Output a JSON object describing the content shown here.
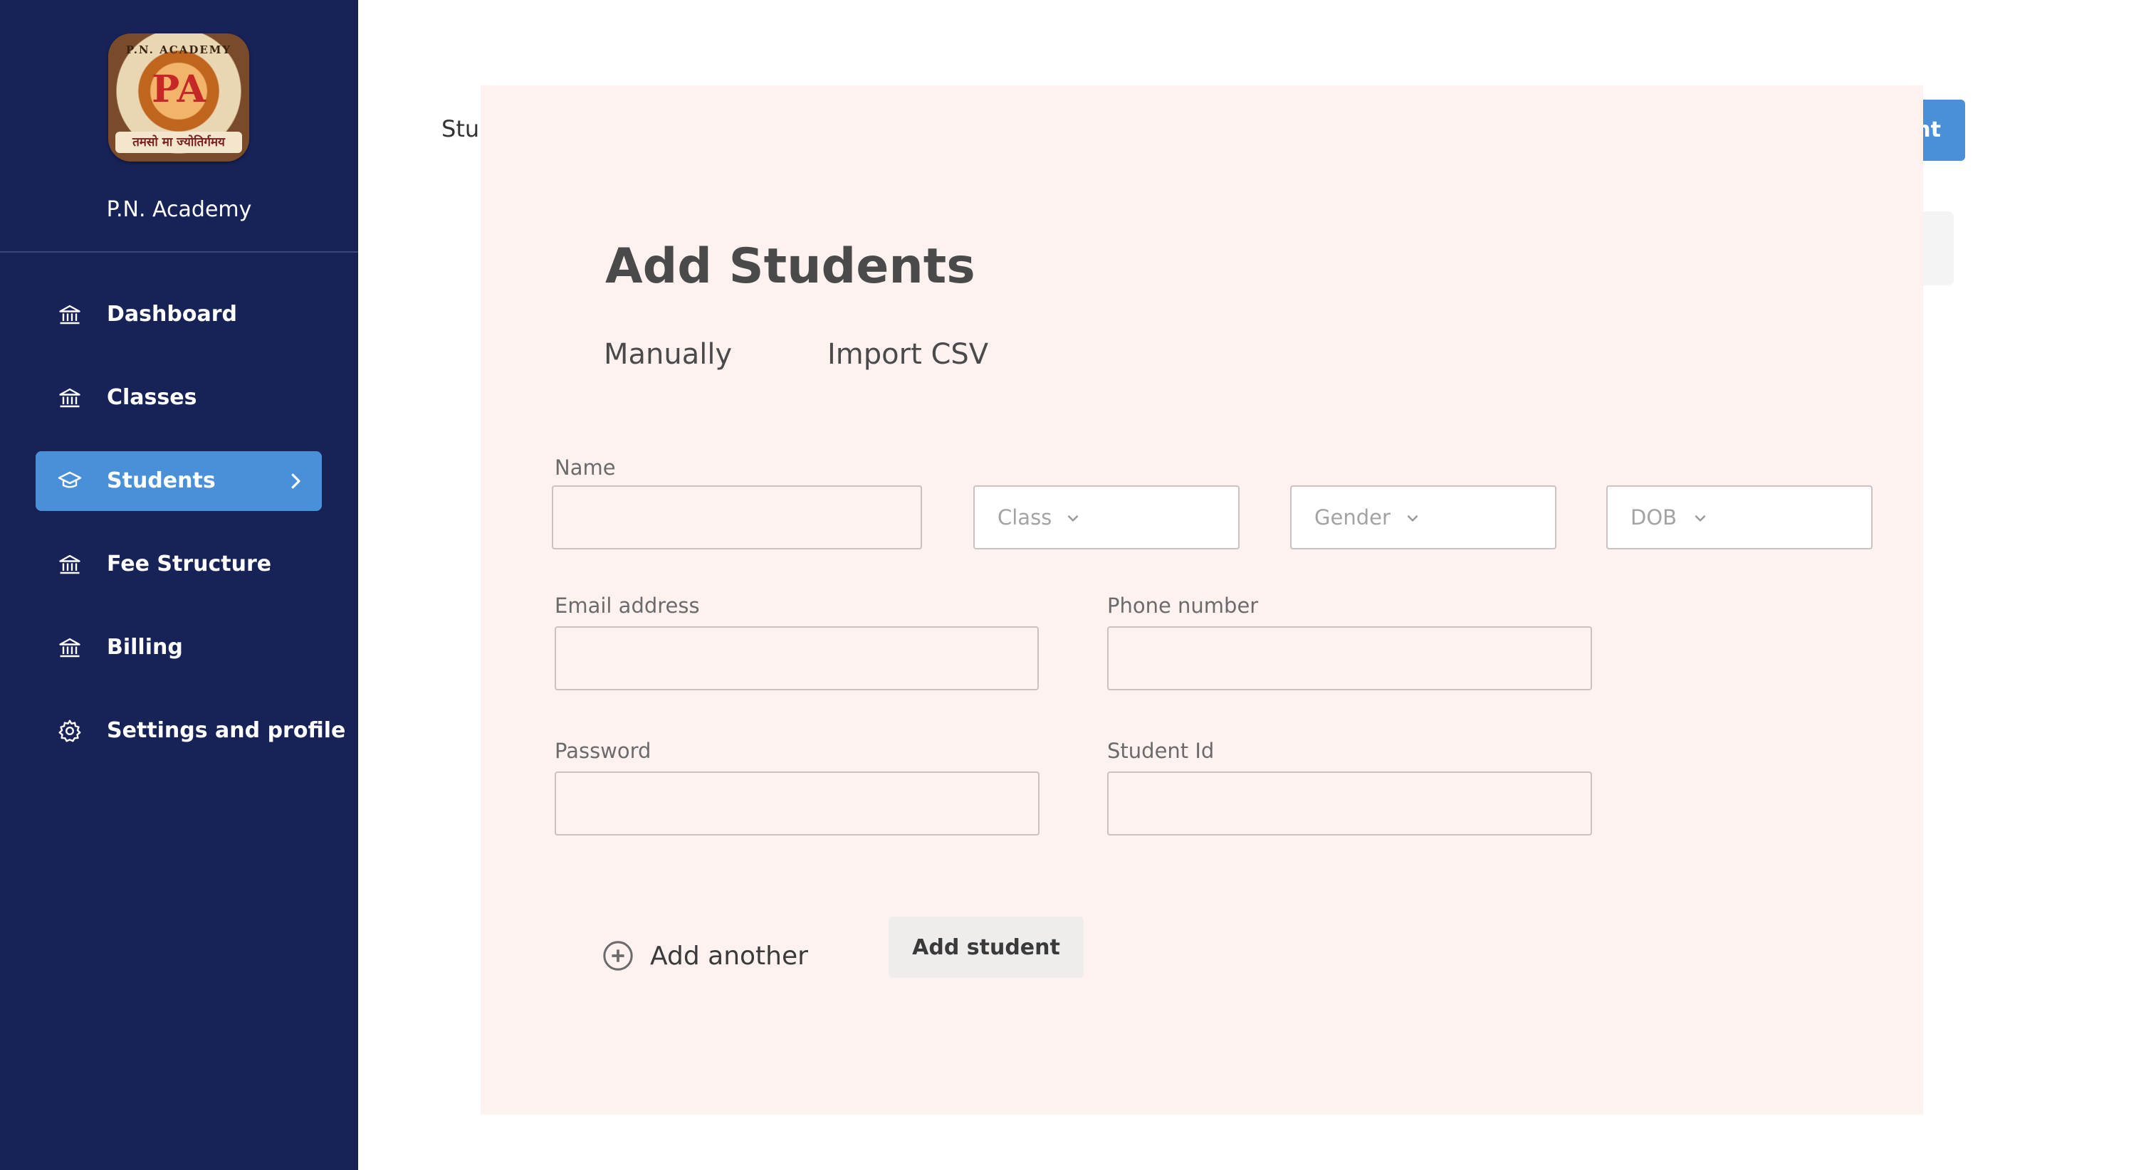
{
  "sidebar": {
    "logo": {
      "monogram": "PA",
      "ring_text": "P.N. ACADEMY",
      "motto": "तमसो मा ज्योतिर्गमय"
    },
    "school_name": "P.N. Academy",
    "items": [
      {
        "label": "Dashboard",
        "icon": "bank-icon",
        "active": false
      },
      {
        "label": "Classes",
        "icon": "bank-icon",
        "active": false
      },
      {
        "label": "Students",
        "icon": "graduation-cap-icon",
        "active": true
      },
      {
        "label": "Fee Structure",
        "icon": "bank-icon",
        "active": false
      },
      {
        "label": "Billing",
        "icon": "bank-icon",
        "active": false
      },
      {
        "label": "Settings and profile",
        "icon": "gear-icon",
        "active": false
      }
    ]
  },
  "background_page": {
    "title_partial": "Stu",
    "add_button_partial": "nt"
  },
  "modal": {
    "title": "Add Students",
    "tabs": [
      {
        "label": "Manually"
      },
      {
        "label": "Import CSV"
      }
    ],
    "fields": {
      "name": {
        "label": "Name",
        "value": ""
      },
      "class": {
        "placeholder": "Class"
      },
      "gender": {
        "placeholder": "Gender"
      },
      "dob": {
        "placeholder": "DOB"
      },
      "email": {
        "label": "Email address",
        "value": ""
      },
      "phone": {
        "label": "Phone number",
        "value": ""
      },
      "password": {
        "label": "Password",
        "value": ""
      },
      "student_id": {
        "label": "Student Id",
        "value": ""
      }
    },
    "add_another_label": "Add another",
    "submit_label": "Add student"
  },
  "colors": {
    "sidebar_bg": "#172257",
    "accent": "#4a90d9",
    "modal_bg": "#fdf2f0"
  }
}
